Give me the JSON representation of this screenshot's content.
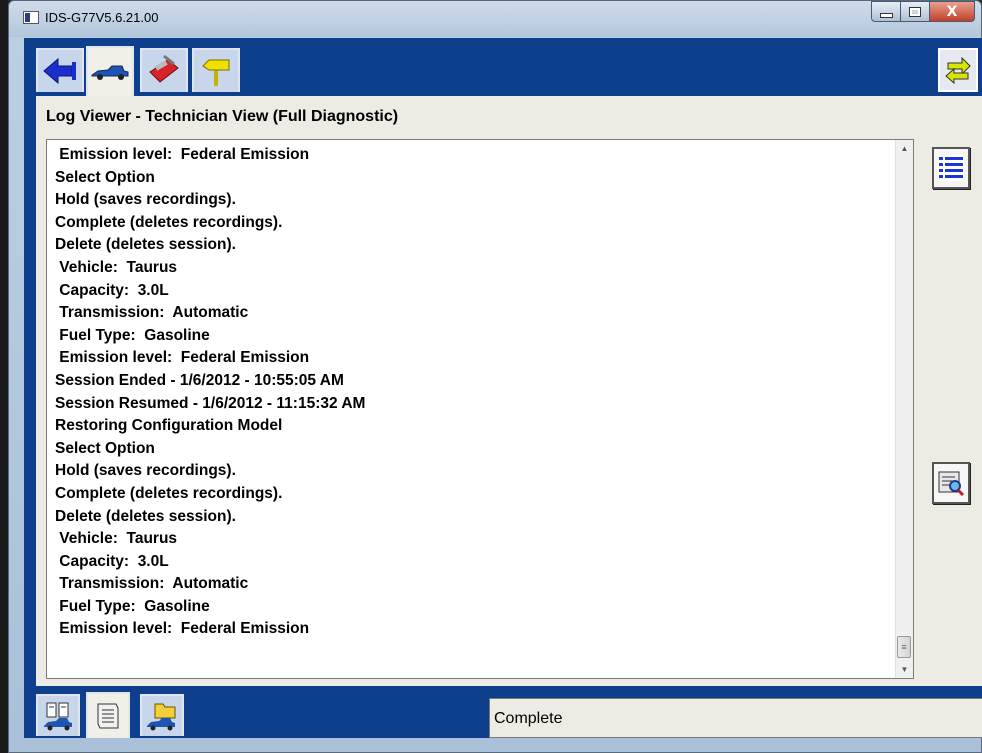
{
  "window": {
    "title": "IDS-G77V5.6.21.00",
    "caption_buttons": [
      "minimize",
      "maximize",
      "close"
    ],
    "close_glyph": "X"
  },
  "toolbar": {
    "tabs": [
      {
        "name": "back-arrow-icon",
        "active": false
      },
      {
        "name": "vehicle-icon",
        "active": true
      },
      {
        "name": "toolbox-icon",
        "active": false
      },
      {
        "name": "signpost-icon",
        "active": false
      }
    ],
    "exchange_button": "exchange-arrows-icon"
  },
  "panel": {
    "title": "Log Viewer - Technician View (Full Diagnostic)"
  },
  "log": {
    "lines": [
      " Emission level:  Federal Emission",
      "Select Option",
      "Hold (saves recordings).",
      "Complete (deletes recordings).",
      "Delete (deletes session).",
      " Vehicle:  Taurus",
      " Capacity:  3.0L",
      " Transmission:  Automatic",
      " Fuel Type:  Gasoline",
      " Emission level:  Federal Emission",
      "Session Ended - 1/6/2012 - 10:55:05 AM",
      "Session Resumed - 1/6/2012 - 11:15:32 AM",
      "Restoring Configuration Model",
      "Select Option",
      "Hold (saves recordings).",
      "Complete (deletes recordings).",
      "Delete (deletes session).",
      " Vehicle:  Taurus",
      " Capacity:  3.0L",
      " Transmission:  Automatic",
      " Fuel Type:  Gasoline",
      " Emission level:  Federal Emission"
    ]
  },
  "side_buttons": [
    "list-icon",
    "report-search-icon"
  ],
  "bottom_tabs": [
    {
      "name": "vehicle-data-icon",
      "active": false
    },
    {
      "name": "scroll-report-icon",
      "active": true
    },
    {
      "name": "folder-vehicle-icon",
      "active": false
    }
  ],
  "status": {
    "text": "Complete"
  },
  "colors": {
    "toolbar_blue": "#0d3f8c",
    "panel_bg": "#ecebe4",
    "tab_active": "#f0efe8"
  }
}
